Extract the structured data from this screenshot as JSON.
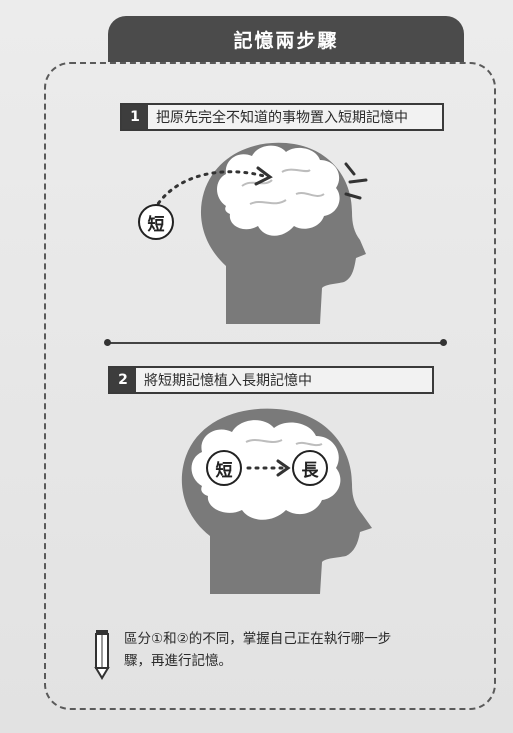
{
  "header": {
    "title": "記憶兩步驟"
  },
  "steps": [
    {
      "number": "1",
      "text": "把原先完全不知道的事物置入短期記憶中"
    },
    {
      "number": "2",
      "text": "將短期記憶植入長期記憶中"
    }
  ],
  "labels": {
    "short": "短",
    "long": "長",
    "short_2": "短"
  },
  "note": {
    "line1": "區分①和②的不同，掌握自己正在執行哪一步",
    "line2": "驟，再進行記憶。"
  },
  "colors": {
    "head": "#7a7a7a",
    "brain": "#ffffff",
    "tab": "#4b4b4b",
    "text": "#2b2b2b"
  },
  "icons": [
    "head-icon",
    "brain-icon",
    "pencil-icon",
    "alert-lines-icon"
  ]
}
